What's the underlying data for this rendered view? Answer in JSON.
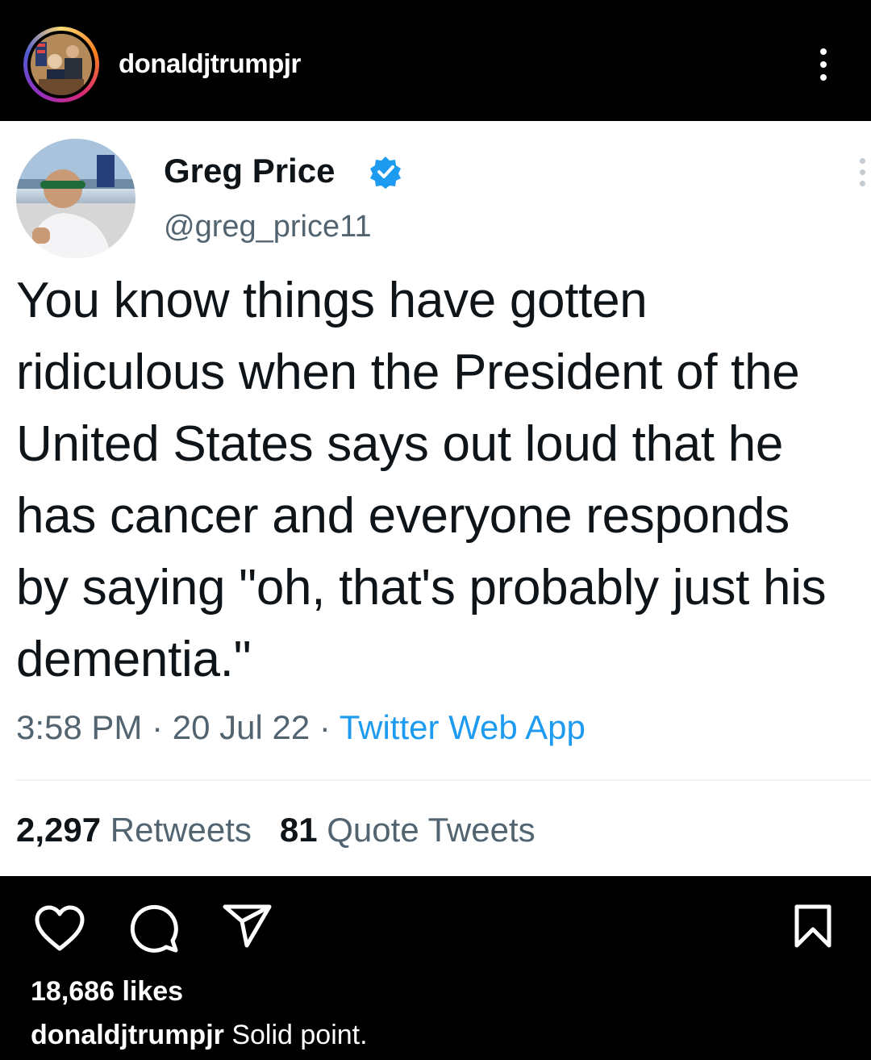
{
  "header": {
    "username": "donaldjtrumpjr",
    "avatar_icon": "profile-photo-icon",
    "more_icon": "more-vertical-icon"
  },
  "tweet": {
    "name": "Greg Price",
    "verified_icon": "verified-badge-icon",
    "handle": "@greg_price11",
    "text": "You know things have gotten ridiculous when the President of the United States says out loud that he has cancer and everyone responds by saying \"oh, that's probably just his dementia.\"",
    "time": "3:58 PM",
    "date": "20 Jul 22",
    "separator": " · ",
    "source": "Twitter Web App",
    "retweets_count": "2,297",
    "retweets_label": "Retweets",
    "quotes_count": "81",
    "quotes_label": "Quote Tweets",
    "colors": {
      "link": "#1d9bf0",
      "muted": "#536471",
      "text": "#0f1419"
    }
  },
  "actions": {
    "like_icon": "heart-icon",
    "comment_icon": "comment-icon",
    "share_icon": "send-icon",
    "save_icon": "bookmark-icon"
  },
  "post": {
    "likes": "18,686 likes",
    "caption_user": "donaldjtrumpjr",
    "caption_text": " Solid point."
  }
}
